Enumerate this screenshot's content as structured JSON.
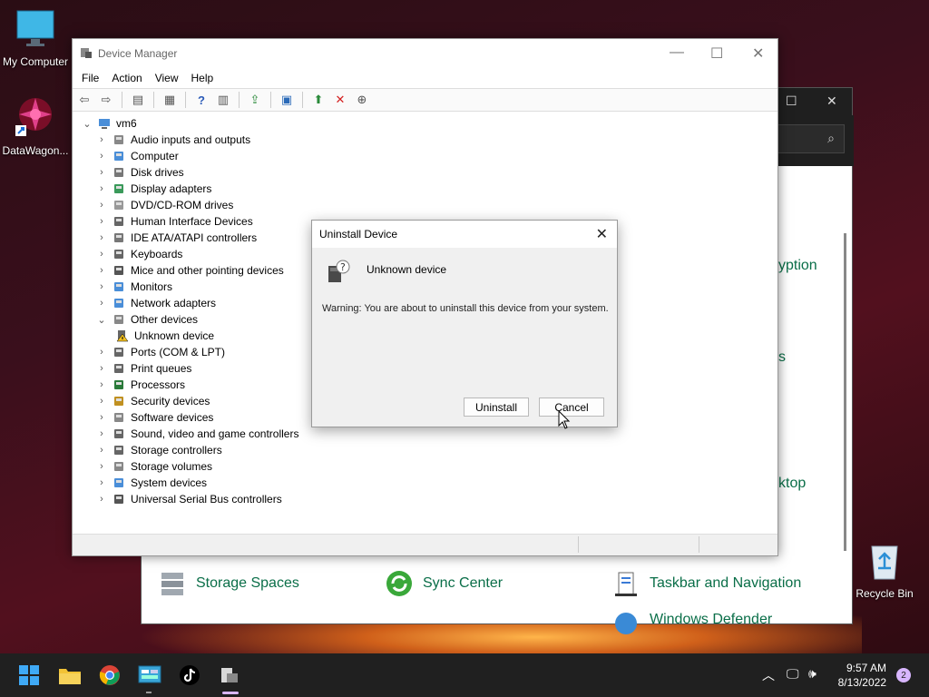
{
  "desktop": {
    "icons": [
      {
        "label": "My Computer"
      },
      {
        "label": "DataWagon..."
      },
      {
        "label": "Recycle Bin"
      }
    ]
  },
  "control_panel": {
    "items": [
      {
        "label": "Storage Spaces"
      },
      {
        "label": "Sync Center"
      },
      {
        "label": "Taskbar and Navigation"
      },
      {
        "label": "Windows Defender"
      }
    ],
    "partial_labels": [
      "yption",
      "s",
      "ktop"
    ]
  },
  "device_manager": {
    "title": "Device Manager",
    "menu": [
      "File",
      "Action",
      "View",
      "Help"
    ],
    "root": "vm6",
    "categories": [
      {
        "label": "Audio inputs and outputs",
        "icon": "speaker-icon"
      },
      {
        "label": "Computer",
        "icon": "computer-icon"
      },
      {
        "label": "Disk drives",
        "icon": "disk-icon"
      },
      {
        "label": "Display adapters",
        "icon": "display-icon"
      },
      {
        "label": "DVD/CD-ROM drives",
        "icon": "dvd-icon"
      },
      {
        "label": "Human Interface Devices",
        "icon": "hid-icon"
      },
      {
        "label": "IDE ATA/ATAPI controllers",
        "icon": "ide-icon"
      },
      {
        "label": "Keyboards",
        "icon": "keyboard-icon"
      },
      {
        "label": "Mice and other pointing devices",
        "icon": "mouse-icon"
      },
      {
        "label": "Monitors",
        "icon": "monitor-icon"
      },
      {
        "label": "Network adapters",
        "icon": "network-icon"
      },
      {
        "label": "Other devices",
        "icon": "other-devices-icon",
        "expanded": true
      },
      {
        "label": "Unknown device",
        "icon": "warning-device-icon",
        "child": true
      },
      {
        "label": "Ports (COM & LPT)",
        "icon": "port-icon"
      },
      {
        "label": "Print queues",
        "icon": "printer-icon"
      },
      {
        "label": "Processors",
        "icon": "processor-icon"
      },
      {
        "label": "Security devices",
        "icon": "security-icon"
      },
      {
        "label": "Software devices",
        "icon": "software-icon"
      },
      {
        "label": "Sound, video and game controllers",
        "icon": "sound-icon"
      },
      {
        "label": "Storage controllers",
        "icon": "storage-controller-icon"
      },
      {
        "label": "Storage volumes",
        "icon": "storage-volume-icon"
      },
      {
        "label": "System devices",
        "icon": "system-icon"
      },
      {
        "label": "Universal Serial Bus controllers",
        "icon": "usb-icon"
      }
    ]
  },
  "dialog": {
    "title": "Uninstall Device",
    "device_name": "Unknown device",
    "warning": "Warning: You are about to uninstall this device from your system.",
    "uninstall_label": "Uninstall",
    "cancel_label": "Cancel"
  },
  "taskbar": {
    "time": "9:57 AM",
    "date": "8/13/2022",
    "notification_count": "2"
  },
  "colors": {
    "accent": "#0a6e48",
    "taskbar": "#202020",
    "error_red": "#d42020"
  }
}
